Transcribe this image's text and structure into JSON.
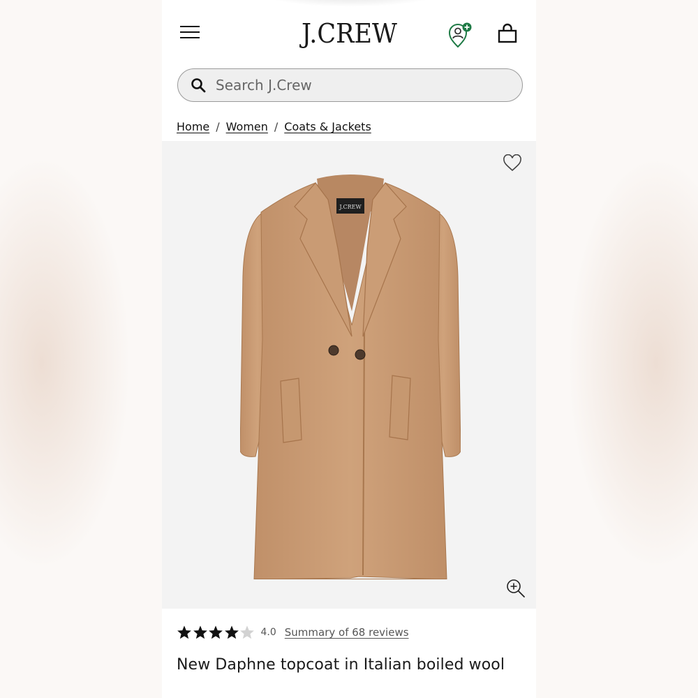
{
  "header": {
    "brand": "J.CREW",
    "menu_icon": "hamburger-menu-icon",
    "account_icon": "account-location-icon",
    "bag_icon": "shopping-bag-icon",
    "accent_color": "#1e7a45"
  },
  "search": {
    "placeholder": "Search J.Crew",
    "value": ""
  },
  "breadcrumb": {
    "items": [
      {
        "label": "Home"
      },
      {
        "label": "Women"
      },
      {
        "label": "Coats & Jackets"
      }
    ],
    "separator": "/"
  },
  "product": {
    "image_icon": "coat-image",
    "coat_color": "#c89a74",
    "wishlist_icon": "heart-icon",
    "zoom_icon": "zoom-in-icon",
    "rating": {
      "stars": 4,
      "max_stars": 5,
      "value_text": "4.0",
      "reviews_link": "Summary of 68 reviews"
    },
    "title": "New Daphne topcoat in Italian boiled wool"
  }
}
